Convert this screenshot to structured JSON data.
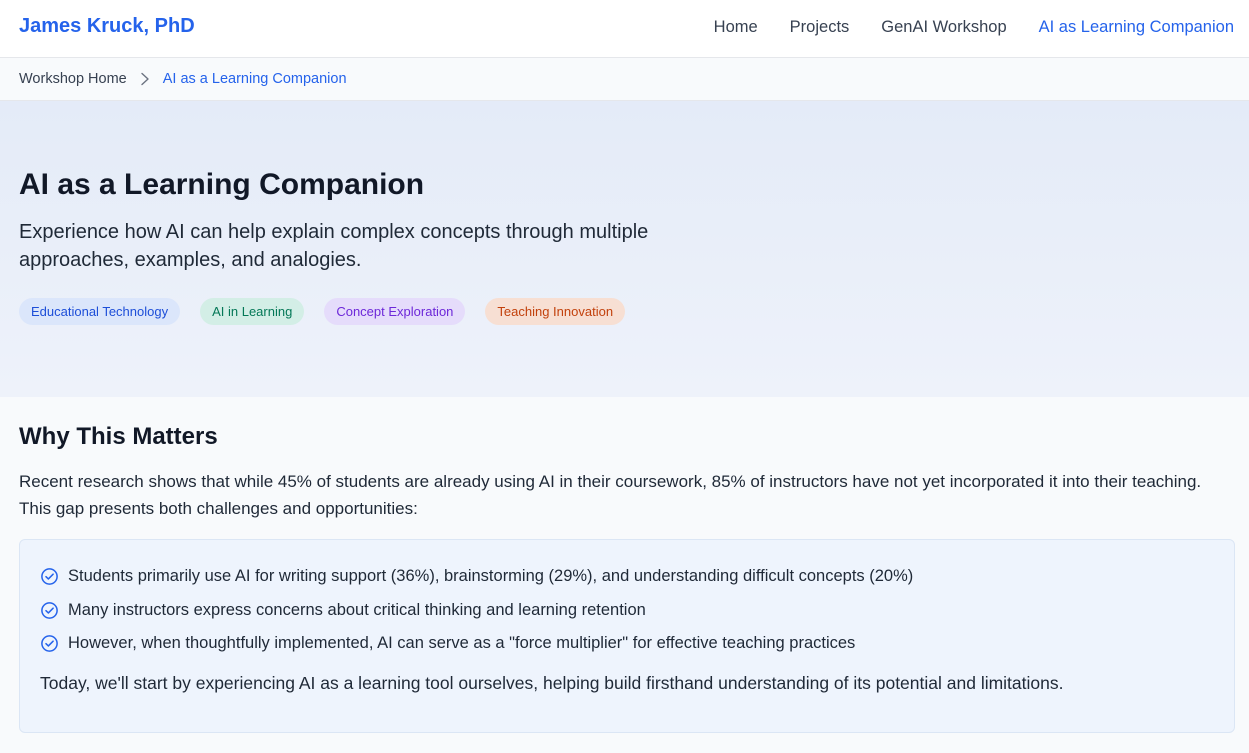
{
  "header": {
    "brand": "James Kruck, PhD",
    "nav": [
      {
        "label": "Home"
      },
      {
        "label": "Projects"
      },
      {
        "label": "GenAI Workshop"
      },
      {
        "label": "AI as Learning Companion",
        "active": true
      }
    ]
  },
  "breadcrumb": {
    "home": "Workshop Home",
    "current": "AI as a Learning Companion"
  },
  "hero": {
    "title": "AI as a Learning Companion",
    "subtitle": "Experience how AI can help explain complex concepts through multiple approaches, examples, and analogies.",
    "tags": [
      "Educational Technology",
      "AI in Learning",
      "Concept Exploration",
      "Teaching Innovation"
    ]
  },
  "why": {
    "heading": "Why This Matters",
    "intro": "Recent research shows that while 45% of students are already using AI in their coursework, 85% of instructors have not yet incorporated it into their teaching. This gap presents both challenges and opportunities:",
    "points": [
      "Students primarily use AI for writing support (36%), brainstorming (29%), and understanding difficult concepts (20%)",
      "Many instructors express concerns about critical thinking and learning retention",
      "However, when thoughtfully implemented, AI can serve as a \"force multiplier\" for effective teaching practices"
    ],
    "closing": "Today, we'll start by experiencing AI as a learning tool ourselves, helping build firsthand understanding of its potential and limitations."
  },
  "colors": {
    "accent": "#2563eb",
    "text": "#1f2937"
  }
}
